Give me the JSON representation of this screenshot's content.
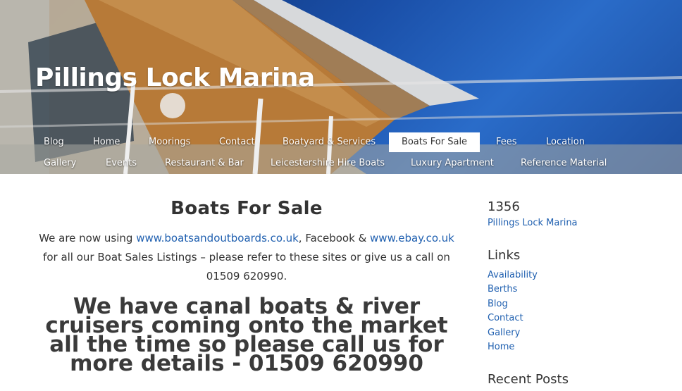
{
  "site": {
    "title": "Pillings Lock Marina"
  },
  "nav": {
    "row1": [
      "Blog",
      "Home",
      "Moorings",
      "Contact",
      "Boatyard & Services",
      "Boats For Sale",
      "Fees",
      "Location"
    ],
    "row2": [
      "Gallery",
      "Events",
      "Restaurant & Bar",
      "Leicestershire Hire Boats",
      "Luxury Apartment",
      "Reference Material"
    ],
    "active": "Boats For Sale"
  },
  "main": {
    "title": "Boats For Sale",
    "intro_1": "We are now using ",
    "link_1": "www.boatsandoutboards.co.uk",
    "intro_2": ", Facebook & ",
    "link_2": "www.ebay.co.uk",
    "intro_3": "for all our Boat Sales Listings – please refer to these sites or give us a call on 01509 620990.",
    "headline": "We have canal boats & river cruisers coming onto the market all the time so please call us for more details - 01509 620990"
  },
  "sidebar": {
    "widget1": {
      "title": "1356",
      "link": "Pillings Lock Marina"
    },
    "links": {
      "title": "Links",
      "items": [
        "Availability",
        "Berths",
        "Blog",
        "Contact",
        "Gallery",
        "Home"
      ]
    },
    "recent": {
      "title": "Recent Posts"
    }
  }
}
